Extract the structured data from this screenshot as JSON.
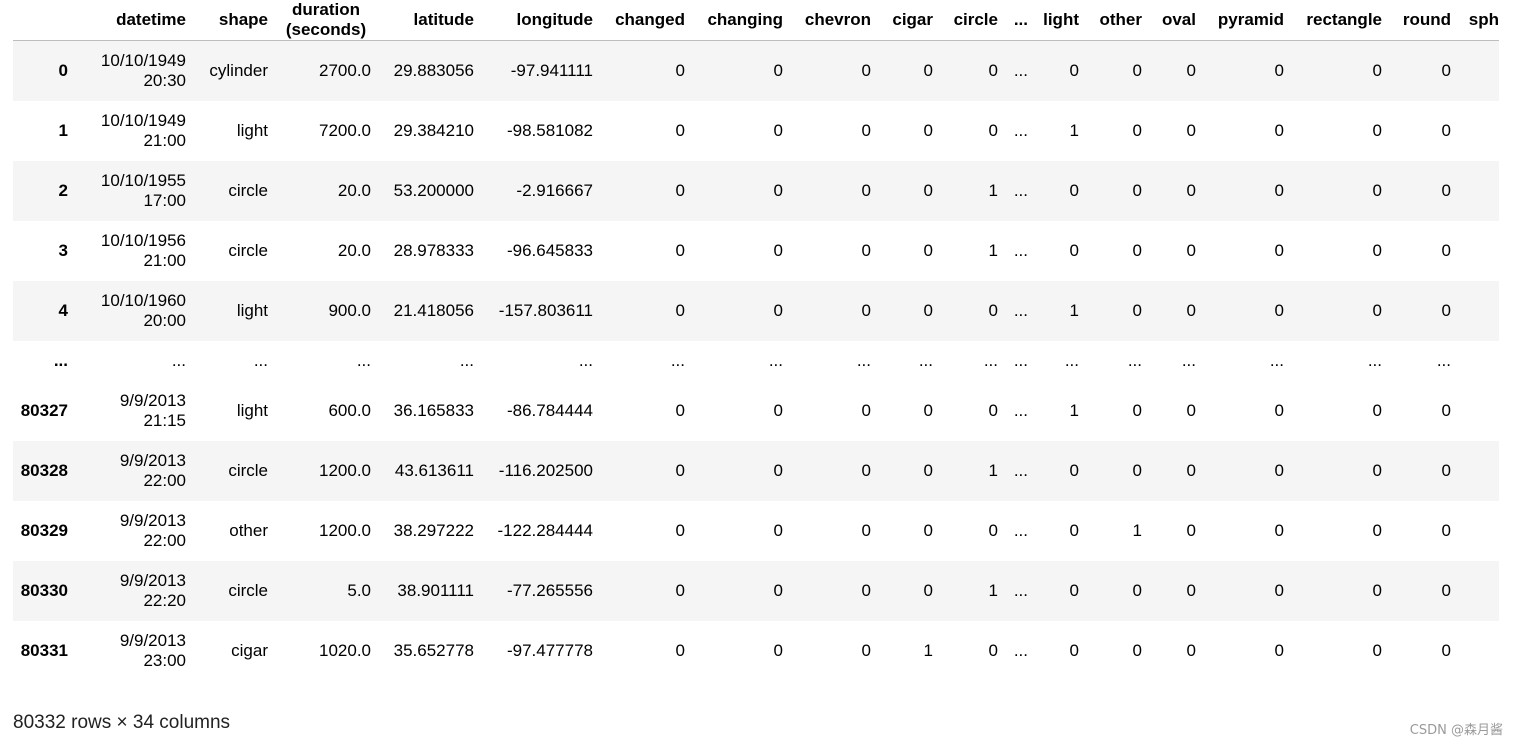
{
  "table": {
    "columns": [
      {
        "key": "index",
        "label": ""
      },
      {
        "key": "datetime",
        "label": "datetime"
      },
      {
        "key": "shape",
        "label": "shape"
      },
      {
        "key": "duration",
        "label": "duration (seconds)"
      },
      {
        "key": "latitude",
        "label": "latitude"
      },
      {
        "key": "longitude",
        "label": "longitude"
      },
      {
        "key": "changed",
        "label": "changed"
      },
      {
        "key": "changing",
        "label": "changing"
      },
      {
        "key": "chevron",
        "label": "chevron"
      },
      {
        "key": "cigar",
        "label": "cigar"
      },
      {
        "key": "circle",
        "label": "circle"
      },
      {
        "key": "ellipsis",
        "label": "..."
      },
      {
        "key": "light",
        "label": "light"
      },
      {
        "key": "other",
        "label": "other"
      },
      {
        "key": "oval",
        "label": "oval"
      },
      {
        "key": "pyramid",
        "label": "pyramid"
      },
      {
        "key": "rectangle",
        "label": "rectangle"
      },
      {
        "key": "round",
        "label": "round"
      },
      {
        "key": "sph",
        "label": "sph"
      }
    ],
    "rows": [
      {
        "index": "0",
        "datetime": "10/10/1949 20:30",
        "shape": "cylinder",
        "duration": "2700.0",
        "latitude": "29.883056",
        "longitude": "-97.941111",
        "changed": "0",
        "changing": "0",
        "chevron": "0",
        "cigar": "0",
        "circle": "0",
        "ellipsis": "...",
        "light": "0",
        "other": "0",
        "oval": "0",
        "pyramid": "0",
        "rectangle": "0",
        "round": "0"
      },
      {
        "index": "1",
        "datetime": "10/10/1949 21:00",
        "shape": "light",
        "duration": "7200.0",
        "latitude": "29.384210",
        "longitude": "-98.581082",
        "changed": "0",
        "changing": "0",
        "chevron": "0",
        "cigar": "0",
        "circle": "0",
        "ellipsis": "...",
        "light": "1",
        "other": "0",
        "oval": "0",
        "pyramid": "0",
        "rectangle": "0",
        "round": "0"
      },
      {
        "index": "2",
        "datetime": "10/10/1955 17:00",
        "shape": "circle",
        "duration": "20.0",
        "latitude": "53.200000",
        "longitude": "-2.916667",
        "changed": "0",
        "changing": "0",
        "chevron": "0",
        "cigar": "0",
        "circle": "1",
        "ellipsis": "...",
        "light": "0",
        "other": "0",
        "oval": "0",
        "pyramid": "0",
        "rectangle": "0",
        "round": "0"
      },
      {
        "index": "3",
        "datetime": "10/10/1956 21:00",
        "shape": "circle",
        "duration": "20.0",
        "latitude": "28.978333",
        "longitude": "-96.645833",
        "changed": "0",
        "changing": "0",
        "chevron": "0",
        "cigar": "0",
        "circle": "1",
        "ellipsis": "...",
        "light": "0",
        "other": "0",
        "oval": "0",
        "pyramid": "0",
        "rectangle": "0",
        "round": "0"
      },
      {
        "index": "4",
        "datetime": "10/10/1960 20:00",
        "shape": "light",
        "duration": "900.0",
        "latitude": "21.418056",
        "longitude": "-157.803611",
        "changed": "0",
        "changing": "0",
        "chevron": "0",
        "cigar": "0",
        "circle": "0",
        "ellipsis": "...",
        "light": "1",
        "other": "0",
        "oval": "0",
        "pyramid": "0",
        "rectangle": "0",
        "round": "0"
      },
      {
        "index": "...",
        "datetime": "...",
        "shape": "...",
        "duration": "...",
        "latitude": "...",
        "longitude": "...",
        "changed": "...",
        "changing": "...",
        "chevron": "...",
        "cigar": "...",
        "circle": "...",
        "ellipsis": "...",
        "light": "...",
        "other": "...",
        "oval": "...",
        "pyramid": "...",
        "rectangle": "...",
        "round": "...",
        "is_ellipsis": true
      },
      {
        "index": "80327",
        "datetime": "9/9/2013 21:15",
        "shape": "light",
        "duration": "600.0",
        "latitude": "36.165833",
        "longitude": "-86.784444",
        "changed": "0",
        "changing": "0",
        "chevron": "0",
        "cigar": "0",
        "circle": "0",
        "ellipsis": "...",
        "light": "1",
        "other": "0",
        "oval": "0",
        "pyramid": "0",
        "rectangle": "0",
        "round": "0"
      },
      {
        "index": "80328",
        "datetime": "9/9/2013 22:00",
        "shape": "circle",
        "duration": "1200.0",
        "latitude": "43.613611",
        "longitude": "-116.202500",
        "changed": "0",
        "changing": "0",
        "chevron": "0",
        "cigar": "0",
        "circle": "1",
        "ellipsis": "...",
        "light": "0",
        "other": "0",
        "oval": "0",
        "pyramid": "0",
        "rectangle": "0",
        "round": "0"
      },
      {
        "index": "80329",
        "datetime": "9/9/2013 22:00",
        "shape": "other",
        "duration": "1200.0",
        "latitude": "38.297222",
        "longitude": "-122.284444",
        "changed": "0",
        "changing": "0",
        "chevron": "0",
        "cigar": "0",
        "circle": "0",
        "ellipsis": "...",
        "light": "0",
        "other": "1",
        "oval": "0",
        "pyramid": "0",
        "rectangle": "0",
        "round": "0"
      },
      {
        "index": "80330",
        "datetime": "9/9/2013 22:20",
        "shape": "circle",
        "duration": "5.0",
        "latitude": "38.901111",
        "longitude": "-77.265556",
        "changed": "0",
        "changing": "0",
        "chevron": "0",
        "cigar": "0",
        "circle": "1",
        "ellipsis": "...",
        "light": "0",
        "other": "0",
        "oval": "0",
        "pyramid": "0",
        "rectangle": "0",
        "round": "0"
      },
      {
        "index": "80331",
        "datetime": "9/9/2013 23:00",
        "shape": "cigar",
        "duration": "1020.0",
        "latitude": "35.652778",
        "longitude": "-97.477778",
        "changed": "0",
        "changing": "0",
        "chevron": "0",
        "cigar": "1",
        "circle": "0",
        "ellipsis": "...",
        "light": "0",
        "other": "0",
        "oval": "0",
        "pyramid": "0",
        "rectangle": "0",
        "round": "0"
      }
    ]
  },
  "footer": {
    "shape_summary": "80332 rows × 34 columns"
  },
  "watermark": {
    "text": "CSDN @森月酱"
  },
  "colors": {
    "odd_row_background": "#f5f5f5",
    "header_border": "#bdbdbd",
    "text": "#000000",
    "watermark": "#9a9a9a"
  }
}
